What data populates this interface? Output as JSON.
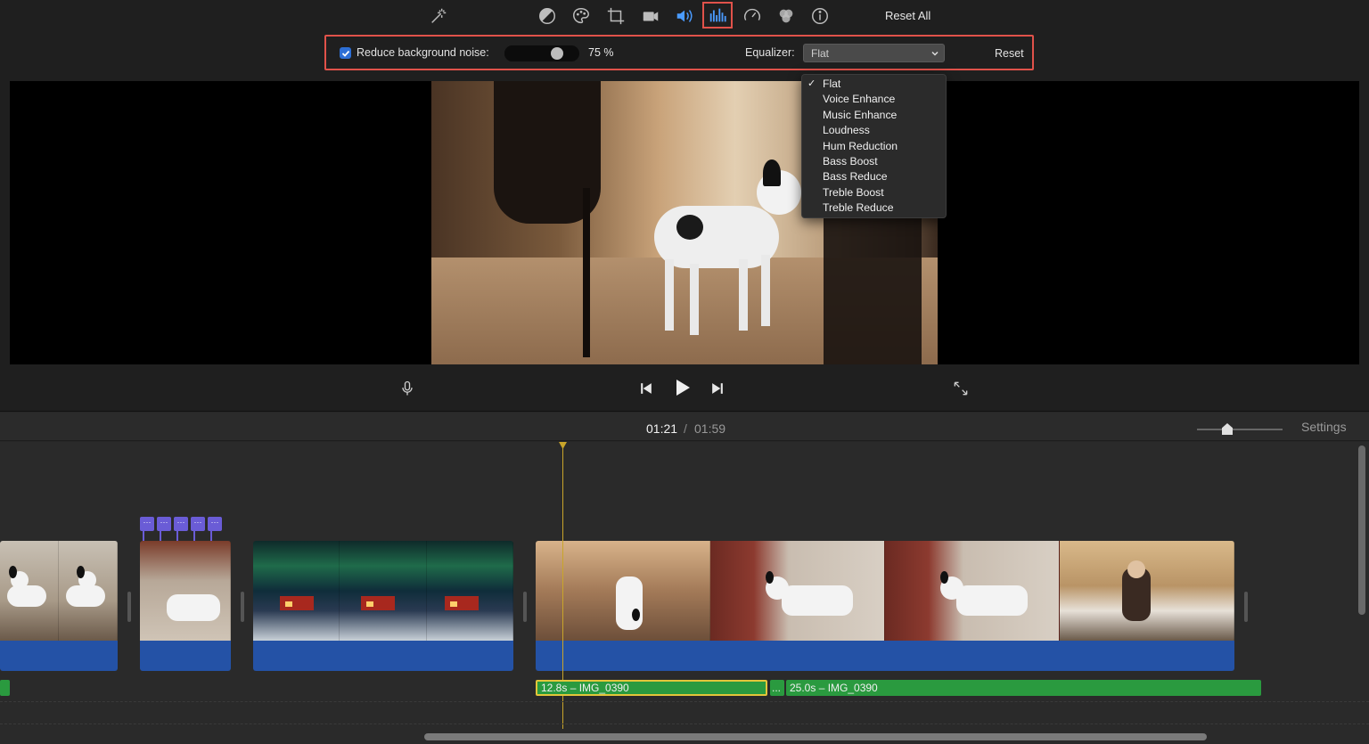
{
  "toolbar": {
    "tools": [
      {
        "name": "magic-wand-icon"
      },
      {
        "name": "color-balance-icon"
      },
      {
        "name": "color-correction-icon"
      },
      {
        "name": "crop-icon"
      },
      {
        "name": "stabilization-icon"
      },
      {
        "name": "volume-icon"
      },
      {
        "name": "noise-reduction-equalizer-icon",
        "active": true
      },
      {
        "name": "speed-icon"
      },
      {
        "name": "clip-filter-icon"
      },
      {
        "name": "info-icon"
      }
    ],
    "reset_all_label": "Reset All",
    "accent_color": "#4a9bff",
    "highlight_color": "#e0524a"
  },
  "audio_panel": {
    "noise_checkbox_checked": true,
    "noise_label": "Reduce background noise:",
    "noise_value_percent": 75,
    "noise_value_label": "75 %",
    "equalizer_label": "Equalizer:",
    "equalizer_selected": "Flat",
    "reset_label": "Reset"
  },
  "equalizer_dropdown": {
    "checkmark": "✓",
    "options": [
      "Flat",
      "Voice Enhance",
      "Music Enhance",
      "Loudness",
      "Hum Reduction",
      "Bass Boost",
      "Bass Reduce",
      "Treble Boost",
      "Treble Reduce"
    ]
  },
  "playback": {
    "controls": [
      "microphone-icon",
      "skip-back-icon",
      "play-icon",
      "skip-forward-icon",
      "fullscreen-icon"
    ]
  },
  "timeline": {
    "time_current": "01:21",
    "time_separator": "/",
    "time_total": "01:59",
    "settings_label": "Settings",
    "marker_glyph": "···",
    "audio_clips": [
      {
        "label": "12.8s – IMG_0390",
        "selected": true
      },
      {
        "label": "...",
        "selected": false
      },
      {
        "label": "25.0s – IMG_0390",
        "selected": false
      }
    ]
  }
}
